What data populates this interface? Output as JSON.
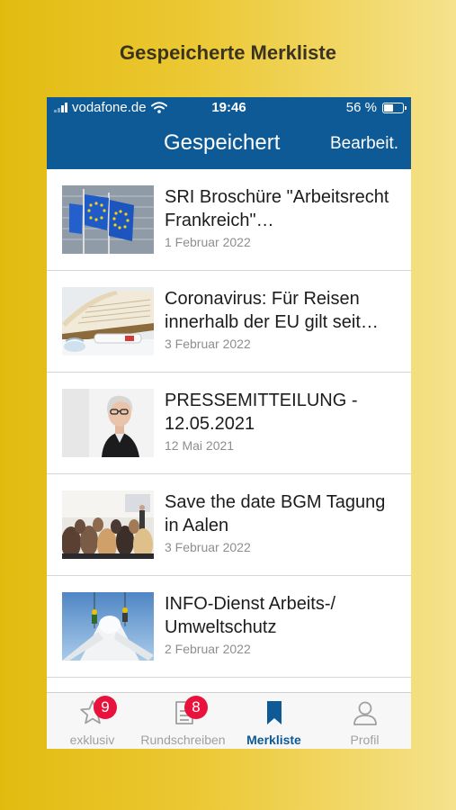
{
  "page_title": "Gespeicherte Merkliste",
  "status_bar": {
    "carrier": "vodafone.de",
    "time": "19:46",
    "battery": "56 %"
  },
  "nav": {
    "title": "Gespeichert",
    "edit": "Bearbeit."
  },
  "items": [
    {
      "title": "SRI Broschüre \"Arbeitsrecht Frankreich\"…",
      "date": "1 Februar 2022",
      "image": "eu-flags-image"
    },
    {
      "title": "Coronavirus: Für Reisen innerhalb der EU gilt seit…",
      "date": "3 Februar 2022",
      "image": "book-test-image"
    },
    {
      "title": "PRESSEMITTEILUNG - 12.05.2021",
      "date": "12 Mai 2021",
      "image": "woman-portrait-image"
    },
    {
      "title": "Save the date BGM Tagung in Aalen",
      "date": "3 Februar 2022",
      "image": "conference-audience-image"
    },
    {
      "title": "INFO-Dienst Arbeits-/ Umweltschutz",
      "date": "2 Februar 2022",
      "image": "wind-turbine-workers-image"
    }
  ],
  "tabs": [
    {
      "label": "exklusiv",
      "icon": "star-icon",
      "badge": "9",
      "active": false
    },
    {
      "label": "Rundschreiben",
      "icon": "document-icon",
      "badge": "8",
      "active": false
    },
    {
      "label": "Merkliste",
      "icon": "bookmark-icon",
      "badge": "",
      "active": true
    },
    {
      "label": "Profil",
      "icon": "person-icon",
      "badge": "",
      "active": false
    }
  ],
  "colors": {
    "primary": "#0d5a96",
    "badge": "#e8123c",
    "background_gold": "#e2bb10"
  }
}
